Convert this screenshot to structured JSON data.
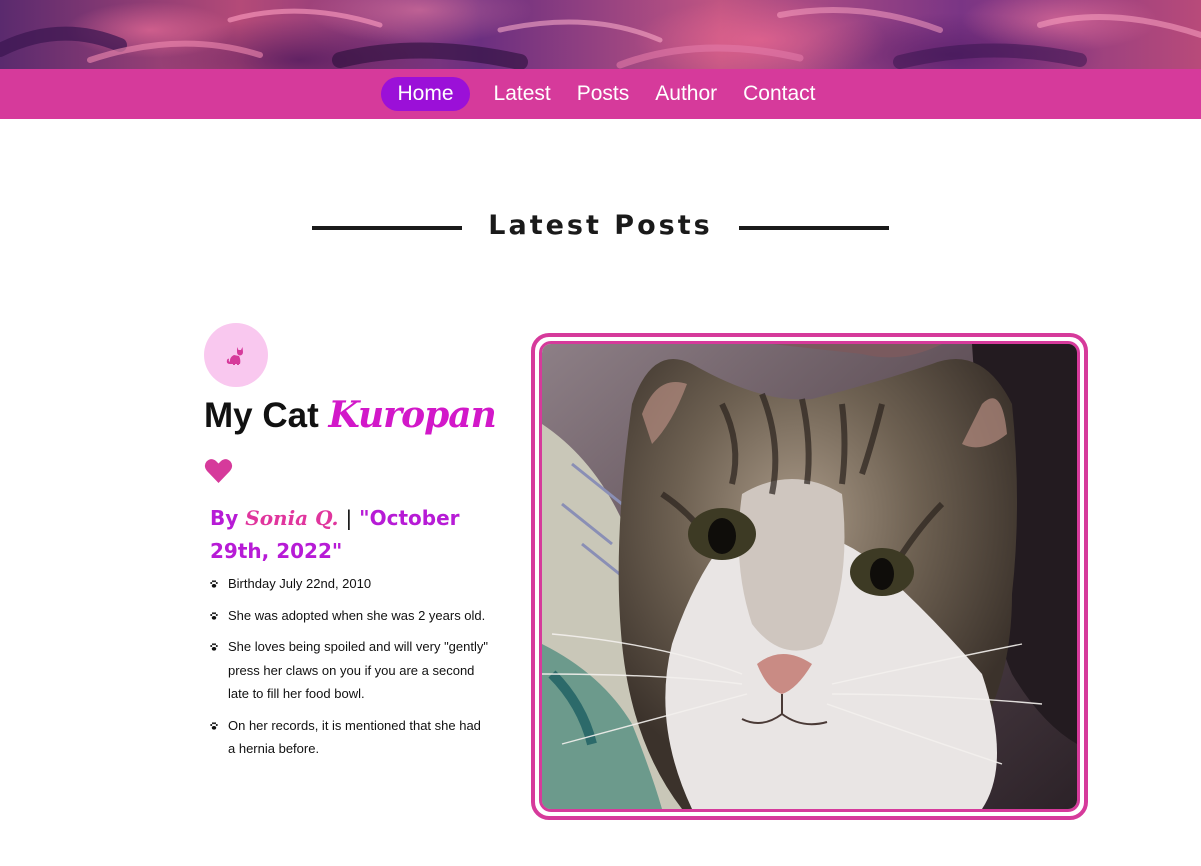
{
  "nav": {
    "items": [
      {
        "label": "Home",
        "active": true
      },
      {
        "label": "Latest",
        "active": false
      },
      {
        "label": "Posts",
        "active": false
      },
      {
        "label": "Author",
        "active": false
      },
      {
        "label": "Contact",
        "active": false
      }
    ]
  },
  "section": {
    "title": "Latest Posts"
  },
  "post": {
    "badge_icon": "cat-icon",
    "title_prefix": "My Cat",
    "title_name": "Kuropan",
    "like_icon": "heart-icon",
    "byline": {
      "by": "By",
      "author": "Sonia Q.",
      "separator": "|",
      "date": "\"October 29th, 2022\""
    },
    "facts": [
      "Birthday July 22nd, 2010",
      "She was adopted when she was 2 years old.",
      "She loves being spoiled and will very \"gently\" press her claws on you if you are a second late to fill her food bowl.",
      "On her records, it is mentioned that she had a hernia before."
    ],
    "bullet_icon": "paw-icon",
    "photo_subject": "tabby-cat-photo"
  },
  "colors": {
    "nav_bg": "#d63a9b",
    "nav_active": "#9b10d8",
    "accent_pink": "#d63a9b",
    "accent_purple": "#b71bd6",
    "badge_bg": "#f9c8ef"
  }
}
